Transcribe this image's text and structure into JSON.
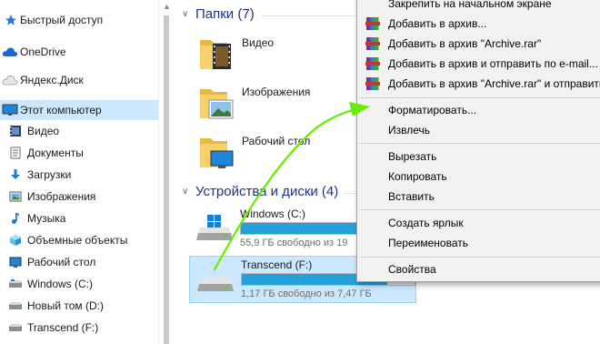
{
  "nav": {
    "items": [
      {
        "label": "Быстрый доступ",
        "icon": "star-icon"
      },
      {
        "label": "OneDrive",
        "icon": "cloud-icon"
      },
      {
        "label": "Яндекс.Диск",
        "icon": "yandex-disk-icon"
      },
      {
        "label": "Этот компьютер",
        "icon": "computer-icon",
        "selected": true
      },
      {
        "label": "Видео",
        "icon": "video-icon"
      },
      {
        "label": "Документы",
        "icon": "documents-icon"
      },
      {
        "label": "Загрузки",
        "icon": "download-icon"
      },
      {
        "label": "Изображения",
        "icon": "pictures-icon"
      },
      {
        "label": "Музыка",
        "icon": "music-icon"
      },
      {
        "label": "Объемные объекты",
        "icon": "3d-objects-icon"
      },
      {
        "label": "Рабочий стол",
        "icon": "desktop-icon"
      },
      {
        "label": "Windows (C:)",
        "icon": "drive-icon"
      },
      {
        "label": "Новый том (D:)",
        "icon": "drive-icon"
      },
      {
        "label": "Transcend (F:)",
        "icon": "drive-icon"
      }
    ]
  },
  "groups": {
    "folders_title": "Папки (7)",
    "drives_title": "Устройства и диски (4)"
  },
  "folders": [
    {
      "name": "Видео",
      "icon": "video-folder-icon"
    },
    {
      "name": "Изображения",
      "icon": "pictures-folder-icon"
    },
    {
      "name": "Рабочий стол",
      "icon": "desktop-folder-icon"
    }
  ],
  "drives": [
    {
      "name": "Windows (C:)",
      "free_text": "55,9 ГБ свободно из 19",
      "used_fraction": 0.71,
      "icon": "windows-drive-icon"
    },
    {
      "name": "Transcend (F:)",
      "free_text": "1,17 ГБ свободно из 7,47 ГБ",
      "used_fraction": 0.84,
      "icon": "usb-drive-icon",
      "selected": true
    }
  ],
  "menu": {
    "items": [
      {
        "label": "Закрепить на начальном экране",
        "icon": ""
      },
      {
        "label": "Добавить в архив...",
        "icon": "winrar-icon"
      },
      {
        "label": "Добавить в архив \"Archive.rar\"",
        "icon": "winrar-icon"
      },
      {
        "label": "Добавить в архив и отправить по e-mail...",
        "icon": "winrar-icon"
      },
      {
        "label": "Добавить в архив \"Archive.rar\" и отправить",
        "icon": "winrar-icon"
      },
      {
        "label": "Форматировать...",
        "icon": ""
      },
      {
        "label": "Извлечь",
        "icon": ""
      },
      {
        "label": "Вырезать",
        "icon": ""
      },
      {
        "label": "Копировать",
        "icon": ""
      },
      {
        "label": "Вставить",
        "icon": ""
      },
      {
        "label": "Создать ярлык",
        "icon": ""
      },
      {
        "label": "Переименовать",
        "icon": ""
      },
      {
        "label": "Свойства",
        "icon": ""
      }
    ]
  },
  "colors": {
    "selection": "#cce8ff",
    "group_title": "#1e3287",
    "bar_fill": "#26a0da",
    "annotation_arrow": "#66ee00"
  }
}
